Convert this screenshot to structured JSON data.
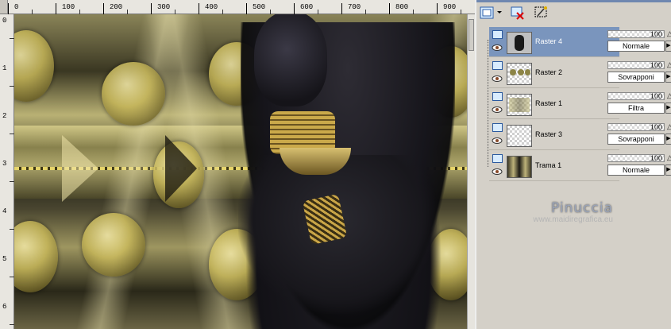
{
  "ruler": {
    "top_labels": [
      "0",
      "100",
      "200",
      "300",
      "400",
      "500",
      "600",
      "700",
      "800",
      "900"
    ],
    "left_labels": [
      "0",
      "1",
      "2",
      "3",
      "4",
      "5",
      "6"
    ]
  },
  "watermark": {
    "name": "Pinuccia",
    "url": "www.maidiregrafica.eu"
  },
  "toolbar": {
    "buttons": [
      "new-layer-icon",
      "delete-layer-icon",
      "mask-icon"
    ]
  },
  "layers": [
    {
      "name": "Raster 4",
      "opacity": "100",
      "blend": "Normale",
      "selected": true
    },
    {
      "name": "Raster 2",
      "opacity": "100",
      "blend": "Sovrapponi",
      "selected": false
    },
    {
      "name": "Raster 1",
      "opacity": "100",
      "blend": "Filtra",
      "selected": false
    },
    {
      "name": "Raster 3",
      "opacity": "100",
      "blend": "Sovrapponi",
      "selected": false
    },
    {
      "name": "Trama 1",
      "opacity": "100",
      "blend": "Normale",
      "selected": false
    }
  ],
  "colors": {
    "selection": "#7a95bd",
    "panel_bg": "#d4d0c8",
    "gold": "#c8b85a"
  }
}
